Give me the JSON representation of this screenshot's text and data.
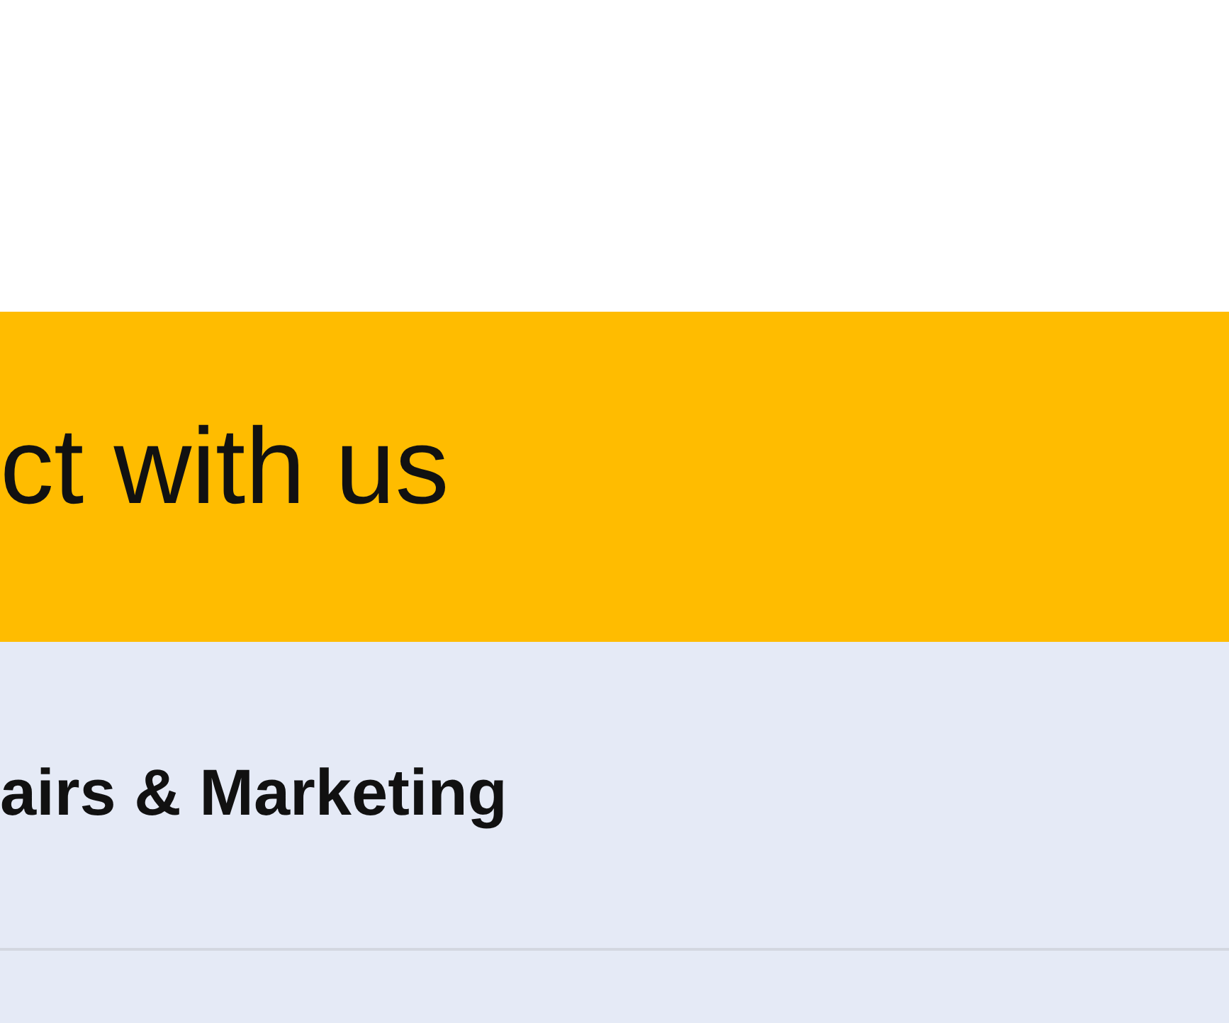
{
  "banner": {
    "heading": "ct with us"
  },
  "list": [
    {
      "label": "airs & Marketing"
    }
  ]
}
